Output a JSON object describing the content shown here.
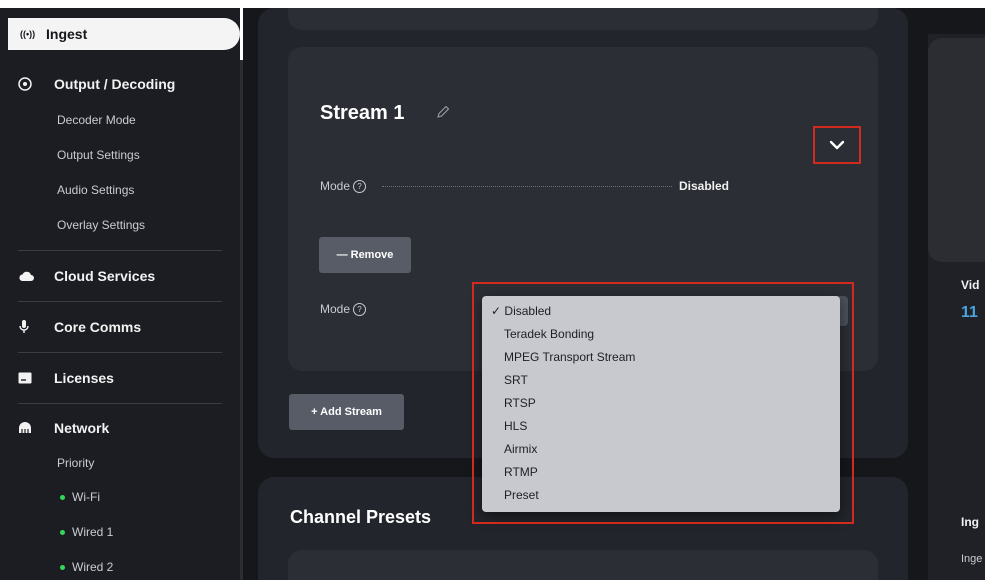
{
  "sidebar": {
    "active": {
      "icon": "((•))",
      "label": "Ingest"
    },
    "output": {
      "label": "Output / Decoding",
      "items": [
        "Decoder Mode",
        "Output Settings",
        "Audio Settings",
        "Overlay Settings"
      ]
    },
    "cloud": {
      "label": "Cloud Services"
    },
    "corecomms": {
      "label": "Core Comms"
    },
    "licenses": {
      "label": "Licenses"
    },
    "network": {
      "label": "Network",
      "priority": "Priority",
      "items": [
        "Wi-Fi",
        "Wired 1",
        "Wired 2"
      ]
    }
  },
  "stream": {
    "title": "Stream 1",
    "mode_label": "Mode",
    "mode_value": "Disabled",
    "remove_label": "— Remove",
    "mode_select_label": "Mode",
    "add_label": "+ Add Stream"
  },
  "dropdown": {
    "checkmark": "✓",
    "options": [
      "Disabled",
      "Teradek Bonding",
      "MPEG Transport Stream",
      "SRT",
      "RTSP",
      "HLS",
      "Airmix",
      "RTMP",
      "Preset"
    ],
    "selected": "Disabled"
  },
  "presets": {
    "title": "Channel Presets"
  },
  "right_panel": {
    "video_label": "Vid",
    "video_value": "11",
    "ingest_label": "Ing",
    "ingest_sub": "Inge"
  },
  "colors": {
    "accent_red": "#d22a1e",
    "status_green": "#35d65a",
    "value_blue": "#4aa3df"
  }
}
